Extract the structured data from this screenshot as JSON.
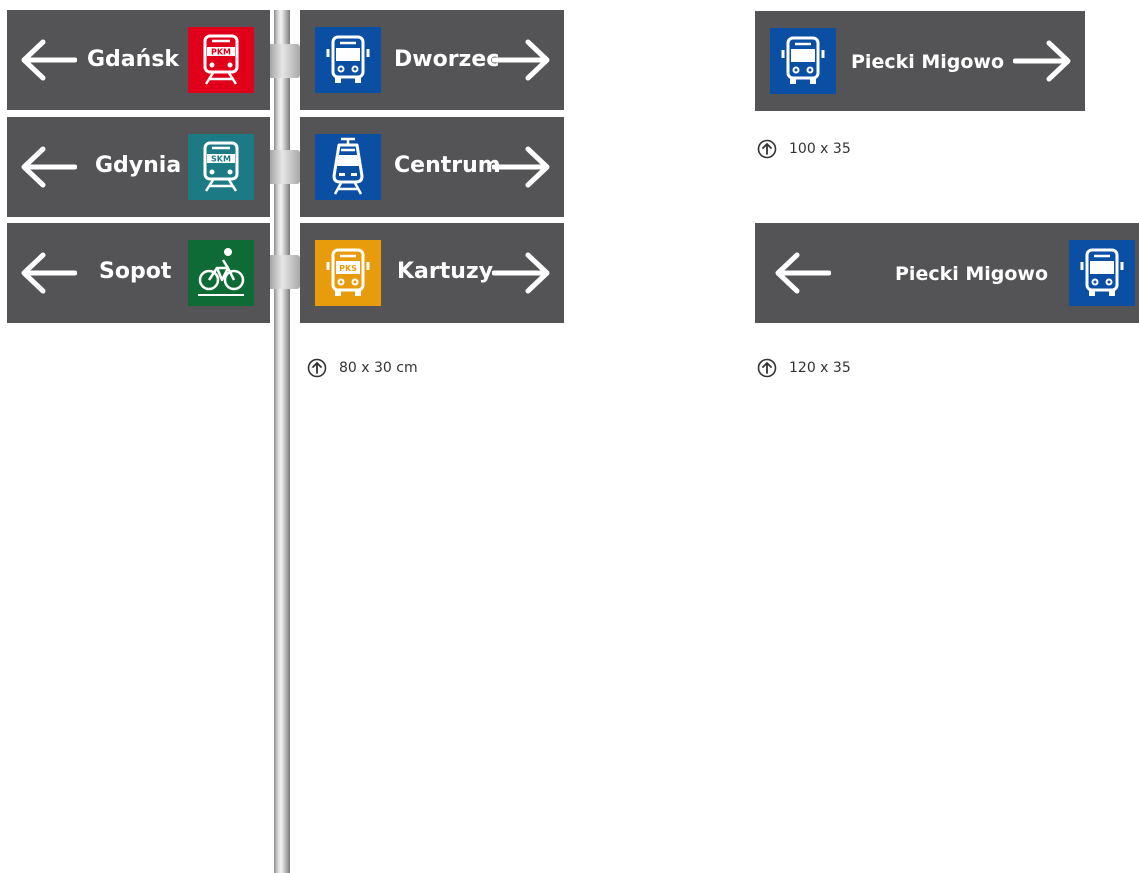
{
  "signpost": {
    "left_signs": [
      {
        "label": "Gdańsk",
        "pictogram": "pkm-train-icon",
        "badge": "PKM",
        "color": "#e1001a"
      },
      {
        "label": "Gdynia",
        "pictogram": "skm-train-icon",
        "badge": "SKM",
        "color": "#1c7a85"
      },
      {
        "label": "Sopot",
        "pictogram": "bicycle-icon",
        "badge": "",
        "color": "#0e6b35"
      }
    ],
    "right_signs": [
      {
        "label": "Dworzec",
        "pictogram": "bus-icon",
        "badge": "",
        "color": "#0a4fa3"
      },
      {
        "label": "Centrum",
        "pictogram": "tram-icon",
        "badge": "",
        "color": "#0a4fa3"
      },
      {
        "label": "Kartuzy",
        "pictogram": "pks-bus-icon",
        "badge": "PKS",
        "color": "#e89b0b"
      }
    ],
    "dimension": "80 x 30 cm"
  },
  "sign_100": {
    "label": "Piecki Migowo",
    "pictogram": "bus-icon",
    "color": "#0a4fa3",
    "dimension": "100 x 35"
  },
  "sign_120": {
    "label": "Piecki Migowo",
    "pictogram": "bus-icon",
    "color": "#0a4fa3",
    "dimension": "120 x 35"
  },
  "colors": {
    "sign_background": "#545456",
    "text": "#ffffff"
  }
}
